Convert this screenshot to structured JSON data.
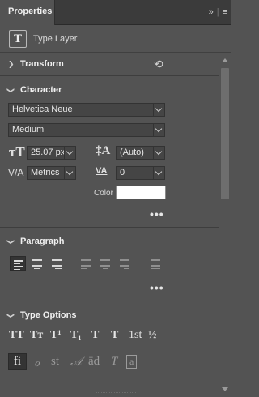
{
  "panel": {
    "tab_label": "Properties",
    "menu_icon": "panel-menu-icon",
    "collapse_icon": "double-chevron-right-icon"
  },
  "layer": {
    "type_label": "Type Layer",
    "icon": "T"
  },
  "transform": {
    "title": "Transform",
    "reset_icon": "reset-transform-icon"
  },
  "character": {
    "title": "Character",
    "font_family": "Helvetica Neue",
    "font_style": "Medium",
    "font_size": "25.07 px",
    "leading": "(Auto)",
    "kerning": "Metrics",
    "tracking": "0",
    "color_label": "Color",
    "color_value": "#ffffff",
    "more_label": "•••"
  },
  "paragraph": {
    "title": "Paragraph",
    "more_label": "•••",
    "alignments": [
      "align-left",
      "align-center",
      "align-right",
      "justify-last-left",
      "justify-last-center",
      "justify-last-right",
      "justify-all"
    ],
    "selected": "align-left"
  },
  "type_options": {
    "title": "Type Options",
    "row1": [
      "TT",
      "Tт",
      "T¹",
      "T₁",
      "T",
      "T",
      "1st",
      "½"
    ],
    "row2": [
      "fi",
      "ℴ",
      "st",
      "𝒜",
      "ād",
      "T",
      "a"
    ]
  }
}
